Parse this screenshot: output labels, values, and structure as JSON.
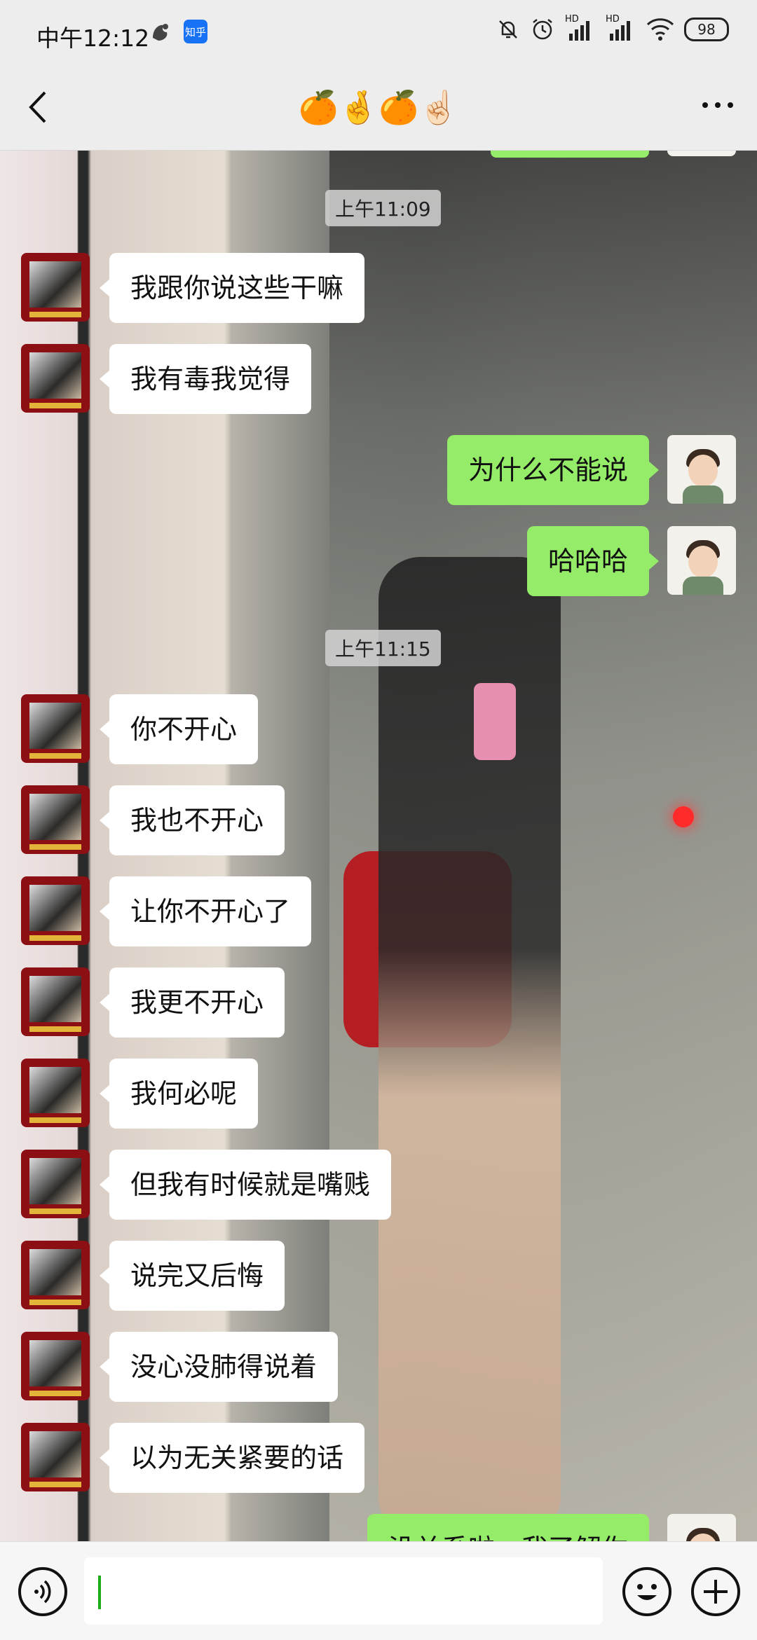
{
  "status_bar": {
    "time": "中午12:12",
    "zhihu": "知乎",
    "hd1": "HD",
    "hd2": "HD",
    "battery": "98"
  },
  "header": {
    "title": "🍊🤞🍊☝🏻"
  },
  "chat": {
    "timestamps": [
      "上午11:09",
      "上午11:15"
    ],
    "messages": [
      {
        "side": "left",
        "text": "我跟你说这些干嘛"
      },
      {
        "side": "left",
        "text": "我有毒我觉得"
      },
      {
        "side": "right",
        "text": "为什么不能说"
      },
      {
        "side": "right",
        "text": "哈哈哈"
      },
      {
        "side": "left",
        "text": "你不开心"
      },
      {
        "side": "left",
        "text": "我也不开心"
      },
      {
        "side": "left",
        "text": "让你不开心了"
      },
      {
        "side": "left",
        "text": "我更不开心"
      },
      {
        "side": "left",
        "text": "我何必呢"
      },
      {
        "side": "left",
        "text": "但我有时候就是嘴贱"
      },
      {
        "side": "left",
        "text": "说完又后悔"
      },
      {
        "side": "left",
        "text": "没心没肺得说着"
      },
      {
        "side": "left",
        "text": "以为无关紧要的话"
      },
      {
        "side": "right",
        "text": "没关系啦，我了解你"
      }
    ]
  },
  "input": {
    "value": ""
  },
  "colors": {
    "accent_green": "#95ec69",
    "bubble_white": "#ffffff",
    "caret": "#1aad19"
  }
}
